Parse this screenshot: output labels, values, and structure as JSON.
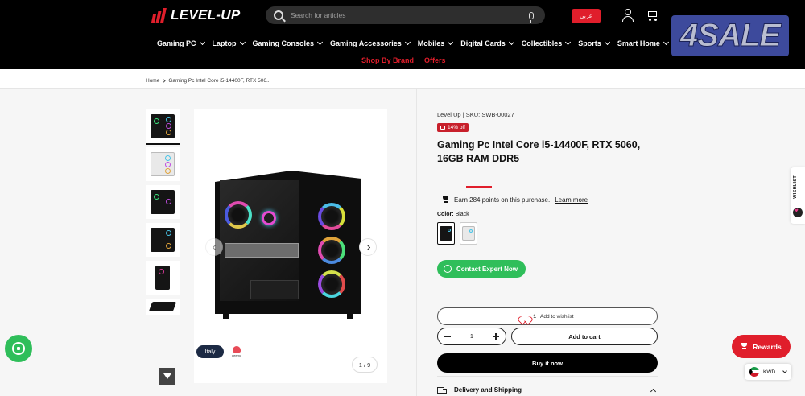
{
  "header": {
    "logo_text": "LEVEL-UP",
    "search_placeholder": "Search for articles",
    "language_label": "عربي",
    "ad_badge": "4SALE"
  },
  "nav": {
    "items": [
      {
        "label": "Gaming PC"
      },
      {
        "label": "Laptop"
      },
      {
        "label": "Gaming Consoles"
      },
      {
        "label": "Gaming Accessories"
      },
      {
        "label": "Mobiles"
      },
      {
        "label": "Digital Cards"
      },
      {
        "label": "Collectibles"
      },
      {
        "label": "Sports"
      },
      {
        "label": "Smart Home"
      }
    ],
    "secondary": [
      "Shop By Brand",
      "Offers"
    ]
  },
  "breadcrumb": {
    "home": "Home",
    "current": "Gaming Pc Intel Core i5-14400F, RTX 506..."
  },
  "gallery": {
    "counter": "1 / 9",
    "badge_italy": "Italy",
    "badge_deemo": "deemo"
  },
  "product": {
    "vendor": "Level Up",
    "sku_label": "SKU: SWB-00027",
    "discount": "14% off",
    "title": "Gaming Pc Intel Core i5-14400F, RTX 5060, 16GB RAM DDR5",
    "points_text": "Earn 284 points on this purchase.",
    "learn_more": "Learn more",
    "color_label": "Color:",
    "color_value": "Black",
    "contact_button": "Contact Expert Now",
    "wishlist_count": "1",
    "wishlist_label": "Add to wishlist",
    "quantity": "1",
    "add_to_cart": "Add to cart",
    "buy_now": "Buy it now",
    "delivery_label": "Delivery and Shipping"
  },
  "floating": {
    "wishlist_tab": "WISHLIST",
    "rewards": "Rewards",
    "currency": "KWD"
  },
  "colors": {
    "brand_red": "#e01e2b",
    "whatsapp_green": "#2fbe5a",
    "header_bg": "#000000"
  }
}
